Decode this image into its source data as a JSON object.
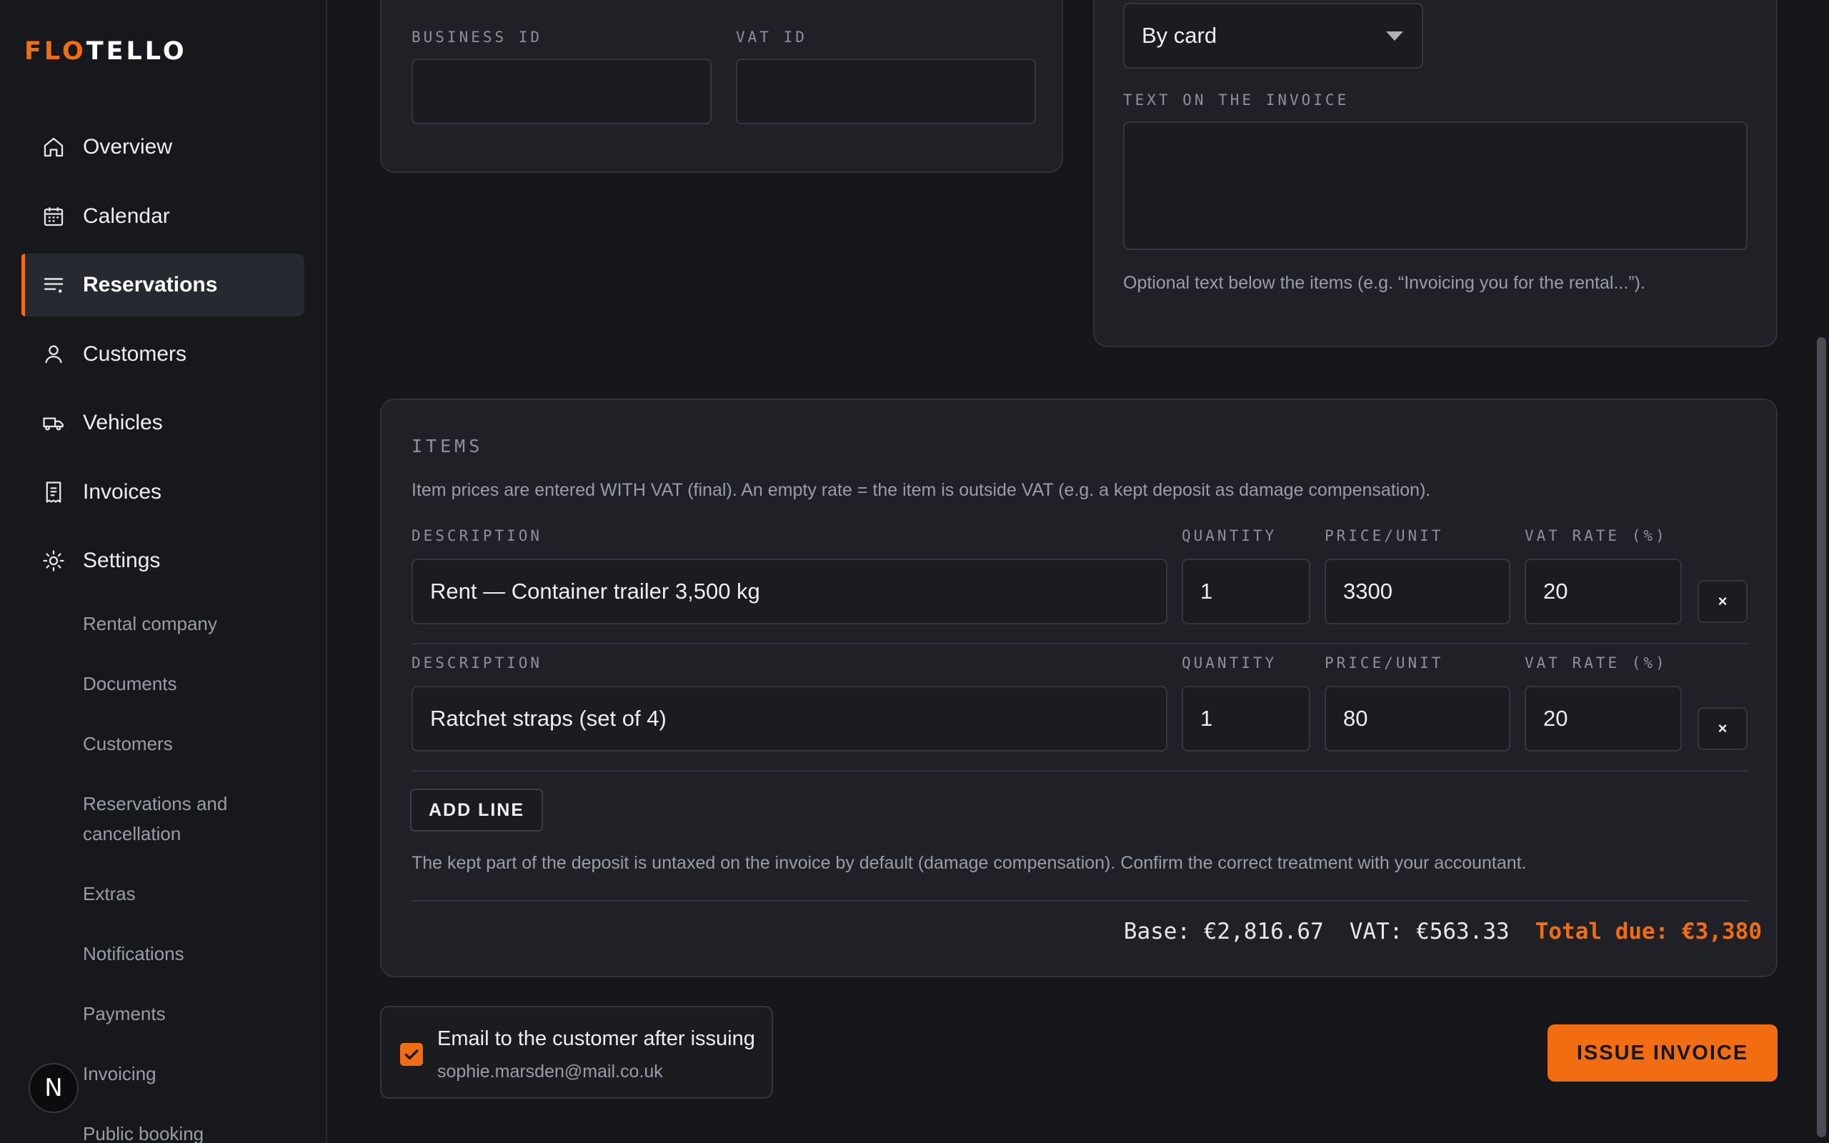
{
  "brand": {
    "prefix": "FLO",
    "suffix": "TELLO",
    "accent": "#f26d12"
  },
  "sidebar": {
    "items": [
      {
        "label": "Overview",
        "icon": "home-icon"
      },
      {
        "label": "Calendar",
        "icon": "calendar-icon"
      },
      {
        "label": "Reservations",
        "icon": "list-icon",
        "active": true
      },
      {
        "label": "Customers",
        "icon": "user-icon"
      },
      {
        "label": "Vehicles",
        "icon": "truck-icon"
      },
      {
        "label": "Invoices",
        "icon": "receipt-icon"
      },
      {
        "label": "Settings",
        "icon": "gear-icon"
      }
    ],
    "subitems": [
      "Rental company",
      "Documents",
      "Customers",
      "Reservations and cancellation",
      "Extras",
      "Notifications",
      "Payments",
      "Invoicing",
      "Public booking"
    ],
    "avatar": "N"
  },
  "company": {
    "business_id_label": "BUSINESS ID",
    "business_id_value": "",
    "vat_id_label": "VAT ID",
    "vat_id_value": ""
  },
  "payment": {
    "method_value": "By card",
    "text_label": "TEXT ON THE INVOICE",
    "text_value": "",
    "text_help": "Optional text below the items (e.g. “Invoicing you for the rental...”)."
  },
  "items": {
    "title": "ITEMS",
    "note": "Item prices are entered WITH VAT (final). An empty rate = the item is outside VAT (e.g. a kept deposit as damage compensation).",
    "col_description": "DESCRIPTION",
    "col_quantity": "QUANTITY",
    "col_price": "PRICE/UNIT",
    "col_vat": "VAT RATE (%)",
    "rows": [
      {
        "description": "Rent — Container trailer 3,500 kg",
        "quantity": "1",
        "price": "3300",
        "vat": "20"
      },
      {
        "description": "Ratchet straps (set of 4)",
        "quantity": "1",
        "price": "80",
        "vat": "20"
      }
    ],
    "remove_label": "×",
    "add_line_label": "ADD LINE",
    "deposit_note": "The kept part of the deposit is untaxed on the invoice by default (damage compensation). Confirm the correct treatment with your accountant.",
    "totals": {
      "base": "Base: €2,816.67",
      "vat": "VAT: €563.33",
      "due": "Total due: €3,380"
    }
  },
  "footer": {
    "email_checked": true,
    "email_label": "Email to the customer after issuing",
    "email_address": "sophie.marsden@mail.co.uk",
    "issue_label": "ISSUE INVOICE"
  }
}
